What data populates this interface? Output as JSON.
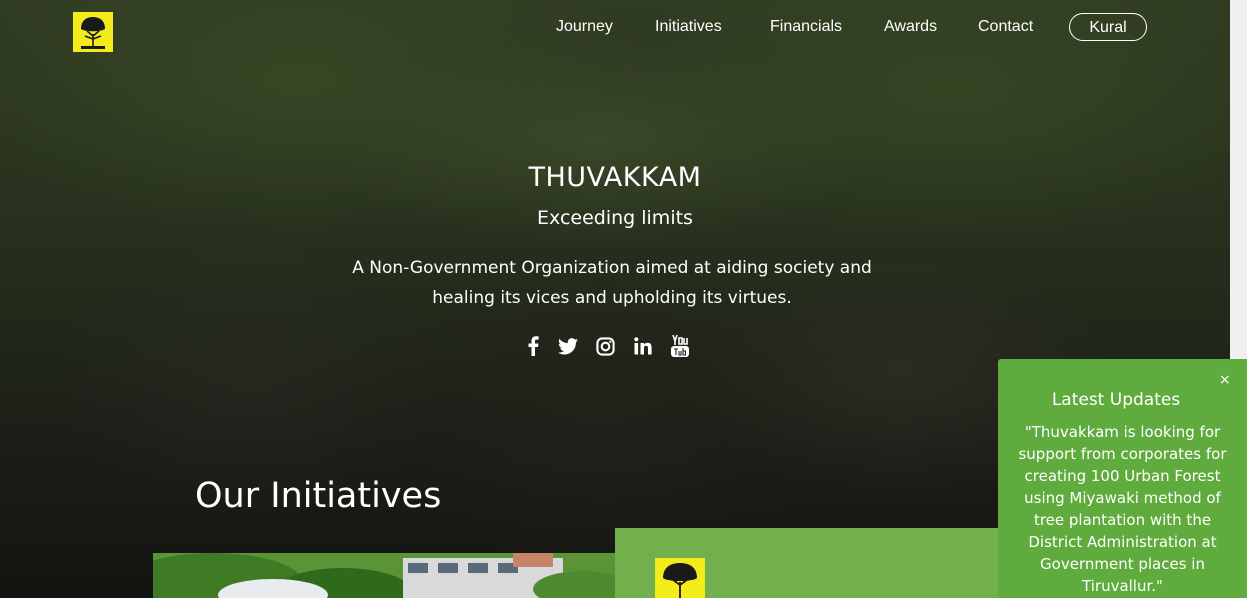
{
  "nav": {
    "logo_icon": "thuvakkam-tree-logo",
    "items": [
      {
        "label": "Journey"
      },
      {
        "label": "Initiatives"
      },
      {
        "label": "Financials"
      },
      {
        "label": "Awards"
      },
      {
        "label": "Contact"
      }
    ],
    "cta_label": "Kural"
  },
  "hero": {
    "title": "THUVAKKAM",
    "subtitle": "Exceeding limits",
    "description_line1": "A Non-Government Organization aimed at aiding society and",
    "description_line2": "healing its vices and upholding its virtues.",
    "social": [
      {
        "icon": "facebook-icon"
      },
      {
        "icon": "twitter-icon"
      },
      {
        "icon": "instagram-icon"
      },
      {
        "icon": "linkedin-icon"
      },
      {
        "icon": "youtube-icon"
      }
    ]
  },
  "initiatives": {
    "section_title": "Our Initiatives"
  },
  "updates": {
    "close_glyph": "×",
    "title": "Latest Updates",
    "text": "\"Thuvakkam is looking for support from corporates for creating 100 Urban Forest using Miyawaki method of tree plantation with the District Administration at Government places in Tiruvallur.\""
  },
  "colors": {
    "accent_green": "#5fab3d",
    "card_green": "#72b04d",
    "logo_yellow": "#f4ec1a"
  }
}
